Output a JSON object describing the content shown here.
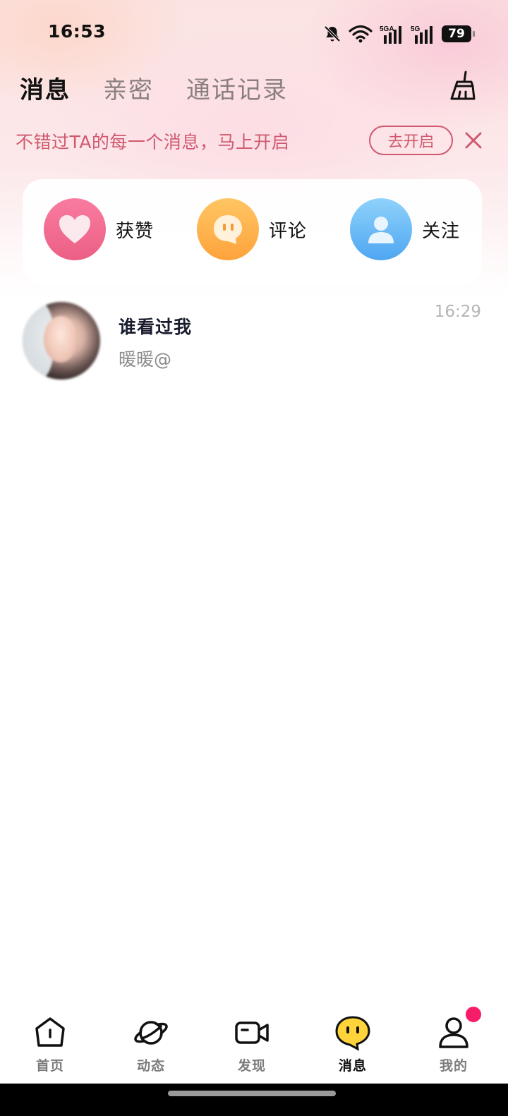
{
  "status_bar": {
    "time": "16:53",
    "network1": "5GA",
    "network2": "5G",
    "battery": "79",
    "icons": [
      "mute-bell-icon",
      "wifi-icon",
      "signal-icon",
      "signal-icon",
      "battery-icon"
    ]
  },
  "header": {
    "tabs": [
      {
        "label": "消息",
        "active": true
      },
      {
        "label": "亲密",
        "active": false
      },
      {
        "label": "通话记录",
        "active": false
      }
    ],
    "clear_icon": "broom-icon"
  },
  "notice": {
    "text": "不错过TA的每一个消息，马上开启",
    "button_label": "去开启",
    "close_icon": "close-icon"
  },
  "actions": [
    {
      "label": "获赞",
      "icon": "heart-icon",
      "color": "#f0648a"
    },
    {
      "label": "评论",
      "icon": "comment-icon",
      "color": "#feaa44"
    },
    {
      "label": "关注",
      "icon": "person-icon",
      "color": "#5aaef4"
    }
  ],
  "messages": [
    {
      "title": "谁看过我",
      "subtitle": "暖暖@",
      "time": "16:29"
    }
  ],
  "bottom_nav": {
    "items": [
      {
        "label": "首页",
        "icon": "home-icon",
        "active": false
      },
      {
        "label": "动态",
        "icon": "planet-icon",
        "active": false
      },
      {
        "label": "发现",
        "icon": "video-camera-icon",
        "active": false
      },
      {
        "label": "消息",
        "icon": "chat-bubble-icon",
        "active": true
      },
      {
        "label": "我的",
        "icon": "profile-icon",
        "active": false,
        "badge": true
      }
    ]
  },
  "colors": {
    "accent_pink": "#d0596f",
    "badge": "#f61c6a",
    "active_chat_icon": "#ffd43b"
  }
}
